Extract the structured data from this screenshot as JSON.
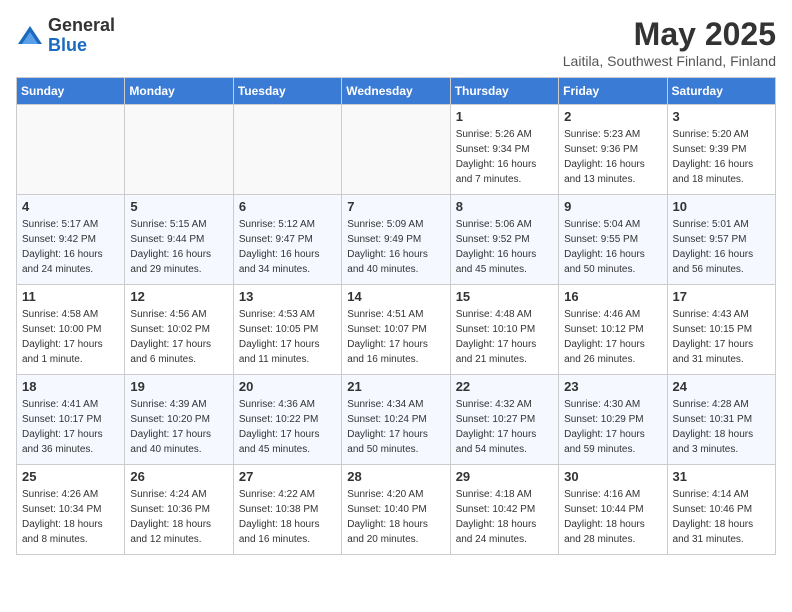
{
  "header": {
    "logo_general": "General",
    "logo_blue": "Blue",
    "month": "May 2025",
    "location": "Laitila, Southwest Finland, Finland"
  },
  "weekdays": [
    "Sunday",
    "Monday",
    "Tuesday",
    "Wednesday",
    "Thursday",
    "Friday",
    "Saturday"
  ],
  "weeks": [
    [
      {
        "day": "",
        "sunrise": "",
        "sunset": "",
        "daylight": "",
        "empty": true
      },
      {
        "day": "",
        "sunrise": "",
        "sunset": "",
        "daylight": "",
        "empty": true
      },
      {
        "day": "",
        "sunrise": "",
        "sunset": "",
        "daylight": "",
        "empty": true
      },
      {
        "day": "",
        "sunrise": "",
        "sunset": "",
        "daylight": "",
        "empty": true
      },
      {
        "day": "1",
        "sunrise": "Sunrise: 5:26 AM",
        "sunset": "Sunset: 9:34 PM",
        "daylight": "Daylight: 16 hours and 7 minutes.",
        "empty": false
      },
      {
        "day": "2",
        "sunrise": "Sunrise: 5:23 AM",
        "sunset": "Sunset: 9:36 PM",
        "daylight": "Daylight: 16 hours and 13 minutes.",
        "empty": false
      },
      {
        "day": "3",
        "sunrise": "Sunrise: 5:20 AM",
        "sunset": "Sunset: 9:39 PM",
        "daylight": "Daylight: 16 hours and 18 minutes.",
        "empty": false
      }
    ],
    [
      {
        "day": "4",
        "sunrise": "Sunrise: 5:17 AM",
        "sunset": "Sunset: 9:42 PM",
        "daylight": "Daylight: 16 hours and 24 minutes.",
        "empty": false
      },
      {
        "day": "5",
        "sunrise": "Sunrise: 5:15 AM",
        "sunset": "Sunset: 9:44 PM",
        "daylight": "Daylight: 16 hours and 29 minutes.",
        "empty": false
      },
      {
        "day": "6",
        "sunrise": "Sunrise: 5:12 AM",
        "sunset": "Sunset: 9:47 PM",
        "daylight": "Daylight: 16 hours and 34 minutes.",
        "empty": false
      },
      {
        "day": "7",
        "sunrise": "Sunrise: 5:09 AM",
        "sunset": "Sunset: 9:49 PM",
        "daylight": "Daylight: 16 hours and 40 minutes.",
        "empty": false
      },
      {
        "day": "8",
        "sunrise": "Sunrise: 5:06 AM",
        "sunset": "Sunset: 9:52 PM",
        "daylight": "Daylight: 16 hours and 45 minutes.",
        "empty": false
      },
      {
        "day": "9",
        "sunrise": "Sunrise: 5:04 AM",
        "sunset": "Sunset: 9:55 PM",
        "daylight": "Daylight: 16 hours and 50 minutes.",
        "empty": false
      },
      {
        "day": "10",
        "sunrise": "Sunrise: 5:01 AM",
        "sunset": "Sunset: 9:57 PM",
        "daylight": "Daylight: 16 hours and 56 minutes.",
        "empty": false
      }
    ],
    [
      {
        "day": "11",
        "sunrise": "Sunrise: 4:58 AM",
        "sunset": "Sunset: 10:00 PM",
        "daylight": "Daylight: 17 hours and 1 minute.",
        "empty": false
      },
      {
        "day": "12",
        "sunrise": "Sunrise: 4:56 AM",
        "sunset": "Sunset: 10:02 PM",
        "daylight": "Daylight: 17 hours and 6 minutes.",
        "empty": false
      },
      {
        "day": "13",
        "sunrise": "Sunrise: 4:53 AM",
        "sunset": "Sunset: 10:05 PM",
        "daylight": "Daylight: 17 hours and 11 minutes.",
        "empty": false
      },
      {
        "day": "14",
        "sunrise": "Sunrise: 4:51 AM",
        "sunset": "Sunset: 10:07 PM",
        "daylight": "Daylight: 17 hours and 16 minutes.",
        "empty": false
      },
      {
        "day": "15",
        "sunrise": "Sunrise: 4:48 AM",
        "sunset": "Sunset: 10:10 PM",
        "daylight": "Daylight: 17 hours and 21 minutes.",
        "empty": false
      },
      {
        "day": "16",
        "sunrise": "Sunrise: 4:46 AM",
        "sunset": "Sunset: 10:12 PM",
        "daylight": "Daylight: 17 hours and 26 minutes.",
        "empty": false
      },
      {
        "day": "17",
        "sunrise": "Sunrise: 4:43 AM",
        "sunset": "Sunset: 10:15 PM",
        "daylight": "Daylight: 17 hours and 31 minutes.",
        "empty": false
      }
    ],
    [
      {
        "day": "18",
        "sunrise": "Sunrise: 4:41 AM",
        "sunset": "Sunset: 10:17 PM",
        "daylight": "Daylight: 17 hours and 36 minutes.",
        "empty": false
      },
      {
        "day": "19",
        "sunrise": "Sunrise: 4:39 AM",
        "sunset": "Sunset: 10:20 PM",
        "daylight": "Daylight: 17 hours and 40 minutes.",
        "empty": false
      },
      {
        "day": "20",
        "sunrise": "Sunrise: 4:36 AM",
        "sunset": "Sunset: 10:22 PM",
        "daylight": "Daylight: 17 hours and 45 minutes.",
        "empty": false
      },
      {
        "day": "21",
        "sunrise": "Sunrise: 4:34 AM",
        "sunset": "Sunset: 10:24 PM",
        "daylight": "Daylight: 17 hours and 50 minutes.",
        "empty": false
      },
      {
        "day": "22",
        "sunrise": "Sunrise: 4:32 AM",
        "sunset": "Sunset: 10:27 PM",
        "daylight": "Daylight: 17 hours and 54 minutes.",
        "empty": false
      },
      {
        "day": "23",
        "sunrise": "Sunrise: 4:30 AM",
        "sunset": "Sunset: 10:29 PM",
        "daylight": "Daylight: 17 hours and 59 minutes.",
        "empty": false
      },
      {
        "day": "24",
        "sunrise": "Sunrise: 4:28 AM",
        "sunset": "Sunset: 10:31 PM",
        "daylight": "Daylight: 18 hours and 3 minutes.",
        "empty": false
      }
    ],
    [
      {
        "day": "25",
        "sunrise": "Sunrise: 4:26 AM",
        "sunset": "Sunset: 10:34 PM",
        "daylight": "Daylight: 18 hours and 8 minutes.",
        "empty": false
      },
      {
        "day": "26",
        "sunrise": "Sunrise: 4:24 AM",
        "sunset": "Sunset: 10:36 PM",
        "daylight": "Daylight: 18 hours and 12 minutes.",
        "empty": false
      },
      {
        "day": "27",
        "sunrise": "Sunrise: 4:22 AM",
        "sunset": "Sunset: 10:38 PM",
        "daylight": "Daylight: 18 hours and 16 minutes.",
        "empty": false
      },
      {
        "day": "28",
        "sunrise": "Sunrise: 4:20 AM",
        "sunset": "Sunset: 10:40 PM",
        "daylight": "Daylight: 18 hours and 20 minutes.",
        "empty": false
      },
      {
        "day": "29",
        "sunrise": "Sunrise: 4:18 AM",
        "sunset": "Sunset: 10:42 PM",
        "daylight": "Daylight: 18 hours and 24 minutes.",
        "empty": false
      },
      {
        "day": "30",
        "sunrise": "Sunrise: 4:16 AM",
        "sunset": "Sunset: 10:44 PM",
        "daylight": "Daylight: 18 hours and 28 minutes.",
        "empty": false
      },
      {
        "day": "31",
        "sunrise": "Sunrise: 4:14 AM",
        "sunset": "Sunset: 10:46 PM",
        "daylight": "Daylight: 18 hours and 31 minutes.",
        "empty": false
      }
    ]
  ]
}
